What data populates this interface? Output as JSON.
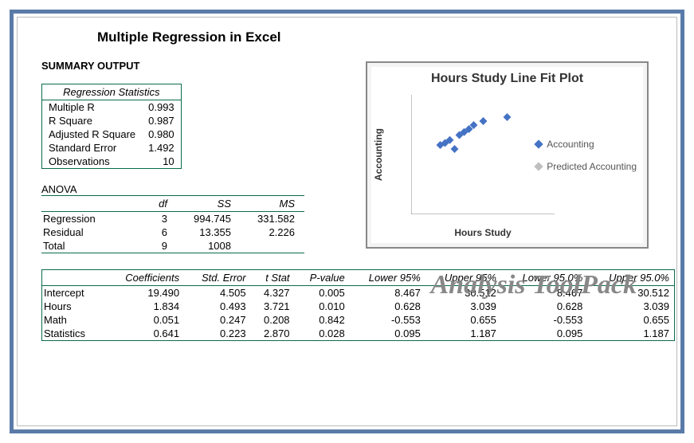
{
  "main_title": "Multiple Regression in Excel",
  "summary_title": "SUMMARY OUTPUT",
  "reg_stats_header": "Regression Statistics",
  "reg_stats": [
    {
      "label": "Multiple R",
      "value": "0.993"
    },
    {
      "label": "R Square",
      "value": "0.987"
    },
    {
      "label": "Adjusted R Square",
      "value": "0.980"
    },
    {
      "label": "Standard Error",
      "value": "1.492"
    },
    {
      "label": "Observations",
      "value": "10"
    }
  ],
  "anova_title": "ANOVA",
  "anova_headers": {
    "col0": "",
    "df": "df",
    "ss": "SS",
    "ms": "MS"
  },
  "anova_rows": [
    {
      "name": "Regression",
      "df": "3",
      "ss": "994.745",
      "ms": "331.582"
    },
    {
      "name": "Residual",
      "df": "6",
      "ss": "13.355",
      "ms": "2.226"
    },
    {
      "name": "Total",
      "df": "9",
      "ss": "1008",
      "ms": ""
    }
  ],
  "coef_headers": {
    "c0": "",
    "c1": "Coefficients",
    "c2": "Std. Error",
    "c3": "t Stat",
    "c4": "P-value",
    "c5": "Lower 95%",
    "c6": "Upper 95%",
    "c7": "Lower 95.0%",
    "c8": "Upper 95.0%"
  },
  "coef_rows": [
    {
      "name": "Intercept",
      "coef": "19.490",
      "se": "4.505",
      "t": "4.327",
      "p": "0.005",
      "l95": "8.467",
      "u95": "30.512",
      "l950": "8.467",
      "u950": "30.512"
    },
    {
      "name": "Hours",
      "coef": "1.834",
      "se": "0.493",
      "t": "3.721",
      "p": "0.010",
      "l95": "0.628",
      "u95": "3.039",
      "l950": "0.628",
      "u950": "3.039"
    },
    {
      "name": "Math",
      "coef": "0.051",
      "se": "0.247",
      "t": "0.208",
      "p": "0.842",
      "l95": "-0.553",
      "u95": "0.655",
      "l950": "-0.553",
      "u950": "0.655"
    },
    {
      "name": "Statistics",
      "coef": "0.641",
      "se": "0.223",
      "t": "2.870",
      "p": "0.028",
      "l95": "0.095",
      "u95": "1.187",
      "l950": "0.095",
      "u950": "1.187"
    }
  ],
  "toolpak_label": "Analysis ToolPack",
  "chart": {
    "title": "Hours Study Line Fit  Plot",
    "xlabel": "Hours Study",
    "ylabel": "Accounting",
    "legend1": "Accounting",
    "legend2": "Predicted Accounting",
    "legend_color1": "#4472c4",
    "legend_color2": "#bfbfbf"
  },
  "chart_data": {
    "type": "scatter",
    "title": "Hours Study Line Fit  Plot",
    "xlabel": "Hours Study",
    "ylabel": "Accounting",
    "xlim": [
      0,
      15
    ],
    "ylim": [
      0,
      120
    ],
    "x_ticks": [
      0,
      5,
      10,
      15
    ],
    "y_ticks": [
      0,
      20,
      40,
      60,
      80,
      100,
      120
    ],
    "series": [
      {
        "name": "Accounting",
        "color": "#4472c4",
        "points": [
          {
            "x": 3,
            "y": 70
          },
          {
            "x": 3.5,
            "y": 72
          },
          {
            "x": 4,
            "y": 75
          },
          {
            "x": 4.5,
            "y": 66
          },
          {
            "x": 5,
            "y": 80
          },
          {
            "x": 5.5,
            "y": 83
          },
          {
            "x": 6,
            "y": 86
          },
          {
            "x": 6.5,
            "y": 90
          },
          {
            "x": 7.5,
            "y": 94
          },
          {
            "x": 10,
            "y": 98
          }
        ]
      },
      {
        "name": "Predicted Accounting",
        "color": "#bfbfbf",
        "points": []
      }
    ]
  }
}
